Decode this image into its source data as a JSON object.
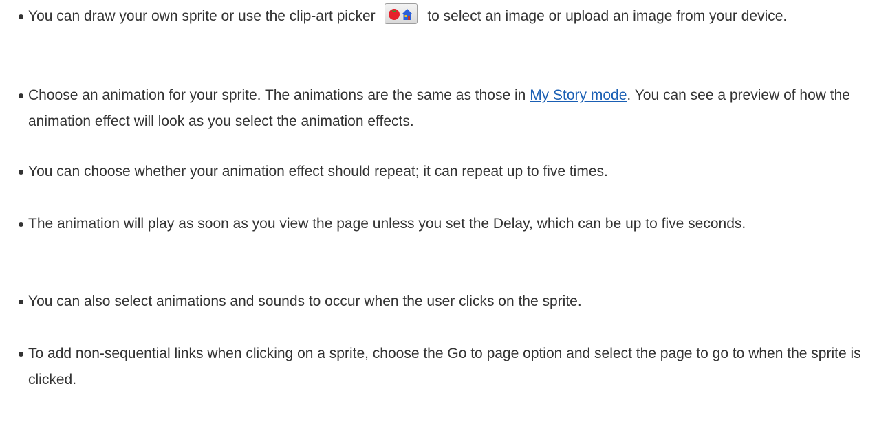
{
  "bullets": [
    {
      "before": "You can draw your own sprite or use the clip-art picker ",
      "after": " to select an image or upload an image from your device."
    },
    {
      "before": "Choose an animation for your sprite. The animations are the same as those in ",
      "link": "My Story mode",
      "after": ". You can see a preview of how the animation effect will look as you select the animation effects."
    },
    {
      "text": "You can choose whether your animation effect should repeat; it can repeat up to five times."
    },
    {
      "text": "The animation will play as soon as you view the page unless you set the Delay, which can be up to five seconds."
    },
    {
      "text": "You can also select animations and sounds to occur when the user clicks on the sprite."
    },
    {
      "text": "To add non-sequential links when clicking on a sprite, choose the Go to page option and select the page to go to when the sprite is clicked."
    }
  ],
  "icons": {
    "clipart_picker": "clipart-picker-icon"
  },
  "colors": {
    "text": "#333333",
    "link": "#1a5fb4"
  }
}
